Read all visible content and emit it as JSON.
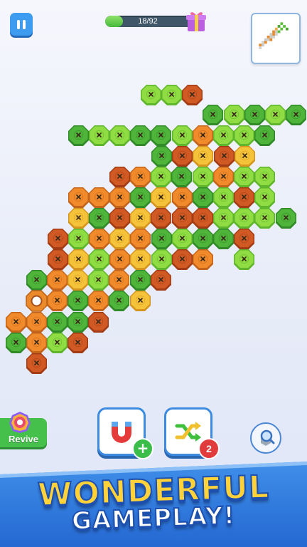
{
  "hud": {
    "progress_text": "18/92",
    "progress_fraction": 0.1957,
    "pause_icon": "pause-icon",
    "gift_icon": "gift-icon",
    "preview_icon": "pixel-carrot-preview"
  },
  "colors": {
    "light_green": "#7fd23c",
    "dark_green": "#3fa534",
    "yellow": "#f0b82d",
    "orange": "#ea8424",
    "dark_orange": "#c8521f"
  },
  "board": [
    [
      2,
      "LG"
    ],
    [
      3,
      "LG"
    ],
    [
      4,
      "DO"
    ],
    [
      4,
      "DG"
    ],
    [
      5,
      "LG"
    ],
    [
      6,
      "DG"
    ],
    [
      7,
      "LG"
    ],
    [
      8,
      "DG"
    ],
    [
      0,
      "DG"
    ],
    [
      1,
      "LG"
    ],
    [
      2,
      "LG"
    ],
    [
      3,
      "DG"
    ],
    [
      4,
      "DG"
    ],
    [
      5,
      "LG"
    ],
    [
      6,
      "OR"
    ],
    [
      7,
      "LG"
    ],
    [
      8,
      "LG"
    ],
    [
      9,
      "DG"
    ],
    [
      2,
      "DG"
    ],
    [
      3,
      "DO"
    ],
    [
      4,
      "YE"
    ],
    [
      5,
      "DO"
    ],
    [
      6,
      "YE"
    ],
    [
      1,
      "DO"
    ],
    [
      2,
      "OR"
    ],
    [
      3,
      "LG"
    ],
    [
      4,
      "DG"
    ],
    [
      5,
      "LG"
    ],
    [
      6,
      "OR"
    ],
    [
      7,
      "LG"
    ],
    [
      8,
      "LG"
    ],
    [
      0,
      "OR"
    ],
    [
      1,
      "OR"
    ],
    [
      2,
      "OR"
    ],
    [
      3,
      "DG"
    ],
    [
      4,
      "YE"
    ],
    [
      5,
      "OR"
    ],
    [
      6,
      "DG"
    ],
    [
      7,
      "LG"
    ],
    [
      8,
      "DO"
    ],
    [
      9,
      "LG"
    ],
    [
      0,
      "YE"
    ],
    [
      1,
      "DG"
    ],
    [
      2,
      "DO"
    ],
    [
      3,
      "YE"
    ],
    [
      4,
      "DO"
    ],
    [
      5,
      "DO"
    ],
    [
      6,
      "DO"
    ],
    [
      7,
      "LG"
    ],
    [
      8,
      "LG"
    ],
    [
      9,
      "LG"
    ],
    [
      10,
      "DG"
    ],
    [
      0,
      "DO"
    ],
    [
      1,
      "LG"
    ],
    [
      2,
      "OR"
    ],
    [
      3,
      "YE"
    ],
    [
      4,
      "OR"
    ],
    [
      5,
      "DG"
    ],
    [
      6,
      "LG"
    ],
    [
      7,
      "DG"
    ],
    [
      8,
      "DG"
    ],
    [
      9,
      "DO"
    ],
    [
      0,
      "OR"
    ],
    [
      1,
      "YE"
    ],
    [
      2,
      "LG"
    ],
    [
      3,
      "OR"
    ],
    [
      4,
      "YE"
    ],
    [
      5,
      "LG"
    ],
    [
      6,
      "DO"
    ],
    [
      7,
      "OR"
    ],
    [
      9,
      "LG"
    ],
    [
      0,
      "DO"
    ],
    [
      1,
      "OR"
    ],
    [
      2,
      "YE"
    ],
    [
      3,
      "LG"
    ],
    [
      4,
      "OR"
    ],
    [
      5,
      "DG"
    ],
    [
      6,
      "DO"
    ],
    [
      0,
      "DG"
    ],
    [
      1,
      "OR"
    ],
    [
      2,
      "DG"
    ],
    [
      3,
      "OR"
    ],
    [
      4,
      "DG"
    ],
    [
      5,
      "YE"
    ],
    [
      0,
      "EMPTY"
    ],
    [
      1,
      "OR"
    ],
    [
      2,
      "DG"
    ],
    [
      3,
      "DG"
    ],
    [
      4,
      "DO"
    ],
    [
      0,
      "OR"
    ],
    [
      1,
      "OR"
    ],
    [
      2,
      "LG"
    ],
    [
      3,
      "DO"
    ],
    [
      0,
      "DG"
    ],
    [
      1,
      "DO"
    ]
  ],
  "revive": {
    "label": "Revive",
    "badge_icon": "revive-badge-icon"
  },
  "tools": {
    "magnet": {
      "icon": "magnet-icon",
      "plus": "+"
    },
    "shuffle": {
      "icon": "shuffle-icon",
      "count": "2"
    },
    "zoom": {
      "icon": "magnifier-icon"
    }
  },
  "banner": {
    "line1": "WONDERFUL",
    "line2": "GAMEPLAY!"
  }
}
